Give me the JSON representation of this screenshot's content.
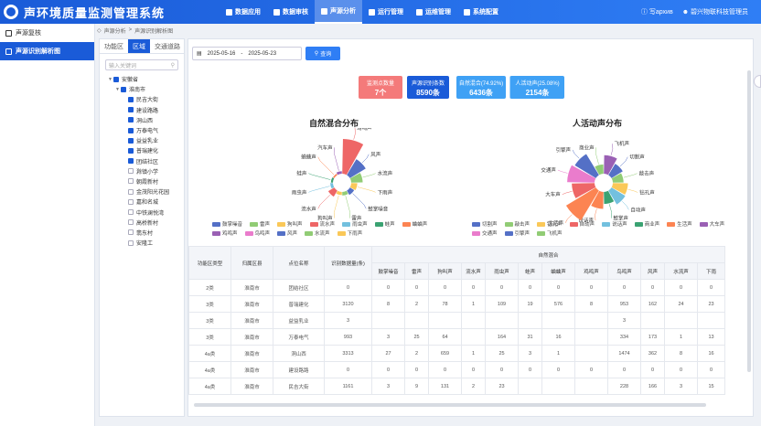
{
  "header": {
    "title": "声环境质量监测管理系统",
    "nav": [
      "数据应用",
      "数据审核",
      "声源分析",
      "运行管理",
      "运维管理",
      "系统配置"
    ],
    "active_index": 2,
    "help": "写архив",
    "user": "碧兴物联科技管理员"
  },
  "sidebar": {
    "items": [
      "声源复核",
      "声源识别解析图"
    ],
    "active_index": 1
  },
  "breadcrumb": [
    "声源分析",
    "声源识别解析图"
  ],
  "left_panel": {
    "tabs": [
      "功能区",
      "区域",
      "交通道路"
    ],
    "active_tab": 1,
    "search_placeholder": "输入关键词",
    "tree": [
      {
        "label": "安徽省",
        "level": 0,
        "checked": true,
        "expand": true
      },
      {
        "label": "淮南市",
        "level": 1,
        "checked": true,
        "expand": true
      },
      {
        "label": "民吉大街",
        "level": 2,
        "checked": true
      },
      {
        "label": "建设路路",
        "level": 2,
        "checked": true
      },
      {
        "label": "洞山西",
        "level": 2,
        "checked": true
      },
      {
        "label": "万泰电气",
        "level": 2,
        "checked": true
      },
      {
        "label": "益益乳业",
        "level": 2,
        "checked": true
      },
      {
        "label": "普瑞建化",
        "level": 2,
        "checked": true
      },
      {
        "label": "团结社区",
        "level": 2,
        "checked": true
      },
      {
        "label": "滁镇小学",
        "level": 2,
        "checked": false
      },
      {
        "label": "朝霞新村",
        "level": 2,
        "checked": false
      },
      {
        "label": "金茂阳光花园",
        "level": 2,
        "checked": false
      },
      {
        "label": "嘉和名城",
        "level": 2,
        "checked": false
      },
      {
        "label": "中铁澜悦湾",
        "level": 2,
        "checked": false
      },
      {
        "label": "高桥新村",
        "level": 2,
        "checked": false
      },
      {
        "label": "翡东村",
        "level": 2,
        "checked": false
      },
      {
        "label": "安隆工",
        "level": 2,
        "checked": false
      }
    ]
  },
  "filter": {
    "start": "2025-05-16",
    "sep": "-",
    "end": "2025-05-23",
    "query": "查询"
  },
  "stats": [
    {
      "label": "监测点数量",
      "value": "7个",
      "color": "#f47a7a"
    },
    {
      "label": "声源识别条数",
      "value": "8590条",
      "color": "#1a5bd8"
    },
    {
      "label": "自然混合(74.92%)",
      "value": "6436条",
      "color": "#3fa1f5"
    },
    {
      "label": "人活动声(25.08%)",
      "value": "2154条",
      "color": "#3fa1f5"
    }
  ],
  "chart_data": [
    {
      "type": "pie",
      "variant": "rose",
      "title": "自然混合分布",
      "categories": [
        "鸟鸣声",
        "风声",
        "水流声",
        "下雨声",
        "鼓掌噪音",
        "雷声",
        "狗叫声",
        "流水声",
        "雨虫声",
        "蛙声",
        "蛐蛐声",
        "汽车声"
      ],
      "values": [
        1474,
        415,
        160,
        45,
        30,
        15,
        12,
        60,
        9,
        5,
        3,
        8
      ],
      "colors": [
        "#ee6666",
        "#5470c6",
        "#91cc75",
        "#fac858",
        "#5470c6",
        "#91cc75",
        "#fac858",
        "#ee6666",
        "#73c0de",
        "#3ba272",
        "#fc8452",
        "#9a60b4"
      ],
      "legend": [
        "鼓掌噪音",
        "雷声",
        "狗叫声",
        "流水声",
        "雨虫声",
        "蛙声",
        "蛐蛐声",
        "鸡鸣声",
        "鸟鸣声",
        "风声",
        "水流声",
        "下雨声"
      ],
      "legend_colors": [
        "#5470c6",
        "#91cc75",
        "#fac858",
        "#ee6666",
        "#73c0de",
        "#3ba272",
        "#fc8452",
        "#9a60b4",
        "#ea7ccc",
        "#5470c6",
        "#91cc75",
        "#fac858"
      ]
    },
    {
      "type": "pie",
      "variant": "rose",
      "title": "人活动声分布",
      "categories": [
        "飞机声",
        "切割声",
        "敲击声",
        "钻孔声",
        "自动声",
        "鼓掌声",
        "说话声",
        "生活声",
        "大车声",
        "交通声",
        "引擎声",
        "商业声"
      ],
      "values": [
        120,
        60,
        40,
        80,
        90,
        50,
        100,
        420,
        180,
        260,
        210,
        30
      ],
      "colors": [
        "#9a60b4",
        "#5470c6",
        "#91cc75",
        "#fac858",
        "#73c0de",
        "#3ba272",
        "#fc8452",
        "#fc8452",
        "#ee6666",
        "#ea7ccc",
        "#5470c6",
        "#91cc75"
      ],
      "legend": [
        "切割声",
        "敲击声",
        "钻孔声",
        "自动声",
        "说话声",
        "商业声",
        "生活声",
        "大车声",
        "交通声",
        "引擎声",
        "飞机声"
      ],
      "legend_colors": [
        "#5470c6",
        "#91cc75",
        "#fac858",
        "#ee6666",
        "#73c0de",
        "#3ba272",
        "#fc8452",
        "#9a60b4",
        "#ea7ccc",
        "#5470c6",
        "#91cc75"
      ]
    }
  ],
  "table": {
    "group_header": "自然混合",
    "headers": [
      "功能区类型",
      "归属区县",
      "点位名称",
      "识别数据量(条)",
      "鼓掌噪音",
      "雷声",
      "狗叫声",
      "流水声",
      "雨虫声",
      "蛙声",
      "蛐蛐声",
      "鸡鸣声",
      "鸟鸣声",
      "风声",
      "水流声",
      "下雨"
    ],
    "rows": [
      [
        "2类",
        "淮南市",
        "团结社区",
        "0",
        "0",
        "0",
        "0",
        "0",
        "0",
        "0",
        "0",
        "0",
        "0",
        "0",
        "0",
        "0"
      ],
      [
        "3类",
        "淮南市",
        "普瑞建化",
        "3120",
        "8",
        "2",
        "78",
        "1",
        "109",
        "19",
        "576",
        "8",
        "953",
        "162",
        "24",
        "23"
      ],
      [
        "3类",
        "淮南市",
        "益益乳业",
        "3",
        "",
        "",
        "",
        "",
        "",
        "",
        "",
        "",
        "3",
        "",
        "",
        ""
      ],
      [
        "3类",
        "淮南市",
        "万泰电气",
        "993",
        "3",
        "25",
        "64",
        "",
        "164",
        "31",
        "16",
        "",
        "334",
        "173",
        "1",
        "13"
      ],
      [
        "4a类",
        "淮南市",
        "洞山西",
        "3313",
        "27",
        "2",
        "659",
        "1",
        "25",
        "3",
        "1",
        "",
        "1474",
        "362",
        "8",
        "16"
      ],
      [
        "4a类",
        "淮南市",
        "建设路路",
        "0",
        "0",
        "0",
        "0",
        "0",
        "0",
        "0",
        "0",
        "0",
        "0",
        "0",
        "0",
        "0"
      ],
      [
        "4a类",
        "淮南市",
        "民吉大街",
        "1161",
        "3",
        "9",
        "131",
        "2",
        "23",
        "",
        "",
        "",
        "228",
        "166",
        "3",
        "15"
      ]
    ]
  }
}
